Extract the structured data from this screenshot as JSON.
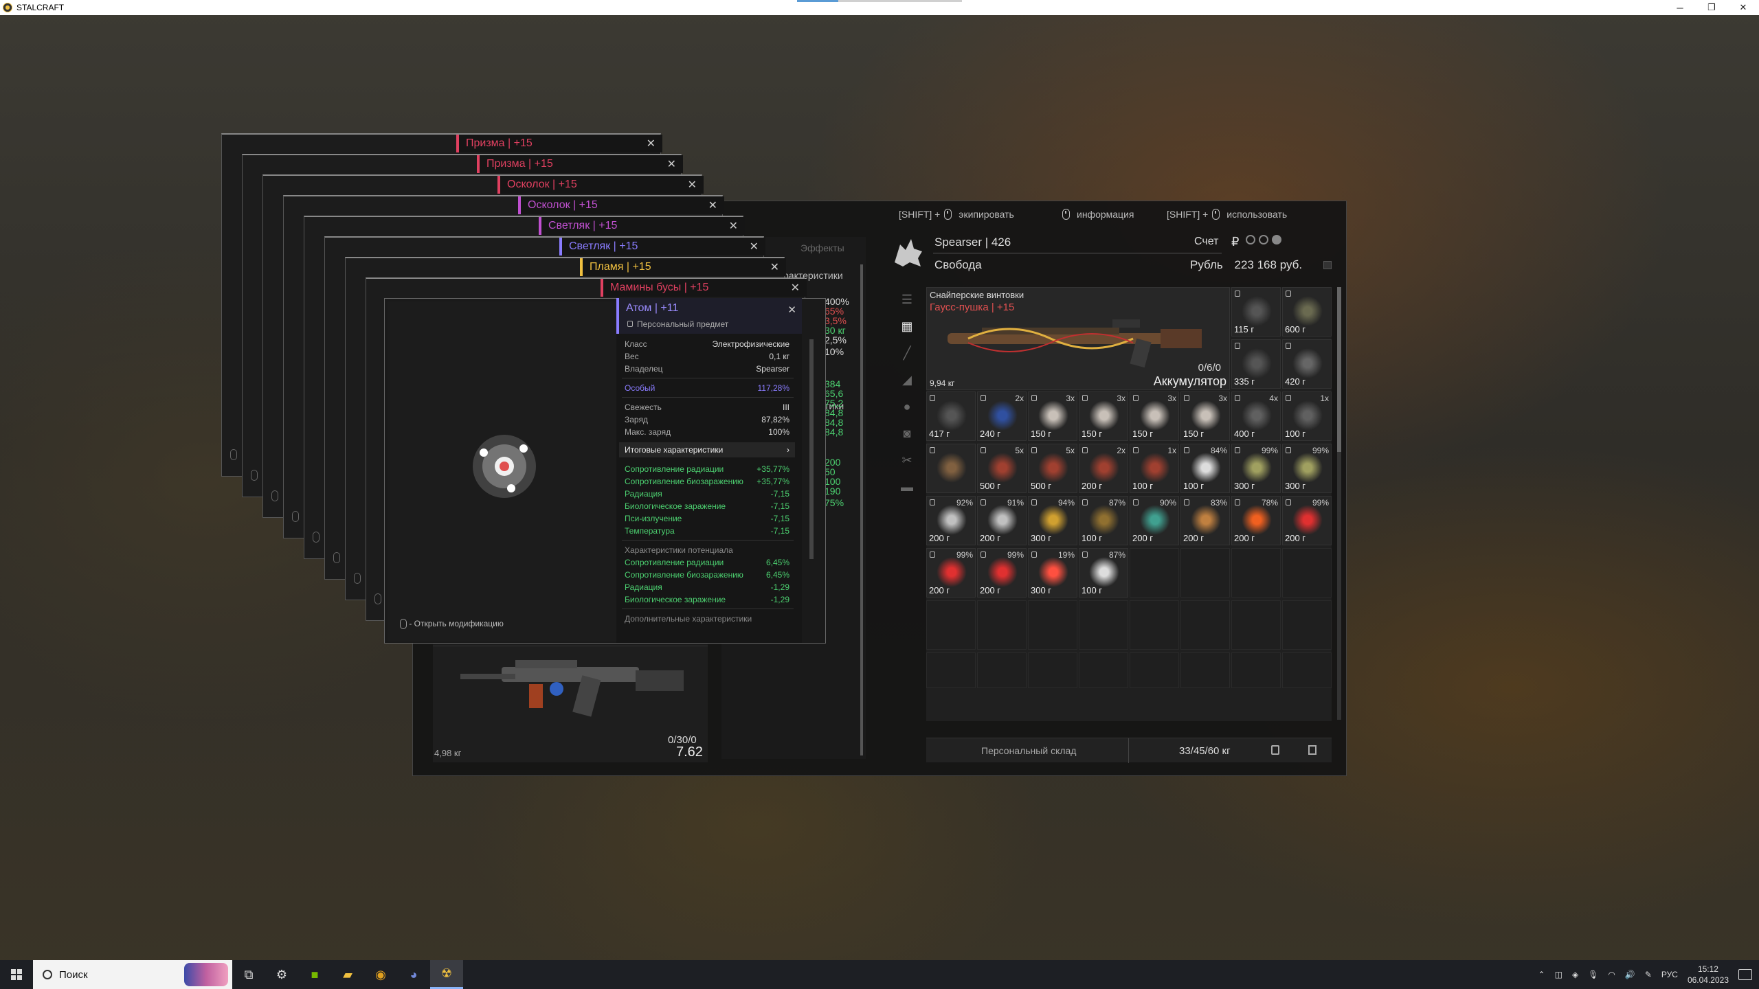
{
  "window": {
    "title": "STALCRAFT",
    "progress": 0.25,
    "buttons": [
      "─",
      "❐",
      "✕"
    ]
  },
  "hints": {
    "equip_shift": "[SHIFT] +",
    "equip": "экипировать",
    "info": "информация",
    "use_shift": "[SHIFT] +",
    "use": "использовать"
  },
  "profile": {
    "name": "Spearser | 426",
    "faction": "Свобода",
    "account_label": "Счет",
    "currency_label": "Рубль",
    "money": "223 168 руб.",
    "currency_symbol": "₽"
  },
  "mid_panel": {
    "tab_effects": "Эффекты",
    "tab_char": "рактеристики",
    "tab_char2": "тики",
    "values": [
      {
        "t": "400%",
        "c": "#dddddd"
      },
      {
        "t": "65%",
        "c": "#e05050"
      },
      {
        "t": "3,5%",
        "c": "#e05050"
      },
      {
        "t": "30 кг",
        "c": "#4cd070"
      },
      {
        "t": "2,5%",
        "c": "#dddddd"
      },
      {
        "t": "10%",
        "c": "#dddddd"
      },
      {
        "t": "384",
        "c": "#4cd070"
      },
      {
        "t": "65,6",
        "c": "#4cd070"
      },
      {
        "t": "75,2",
        "c": "#4cd070"
      },
      {
        "t": "84,8",
        "c": "#4cd070"
      },
      {
        "t": "84,8",
        "c": "#4cd070"
      },
      {
        "t": "84,8",
        "c": "#4cd070"
      },
      {
        "t": "200",
        "c": "#4cd070"
      },
      {
        "t": "50",
        "c": "#4cd070"
      },
      {
        "t": "100",
        "c": "#4cd070"
      },
      {
        "t": "190",
        "c": "#4cd070"
      },
      {
        "t": "75%",
        "c": "#4cd070"
      }
    ]
  },
  "left_weapon": {
    "weight": "4,98 кг",
    "ammo": "0/30/0",
    "caliber": "7.62"
  },
  "inventory": {
    "category": "Снайперские винтовки",
    "weapon_name": "Гаусс-пушка | +15",
    "weapon_ammo": "0/6/0",
    "weapon_accessory": "Аккумулятор",
    "weapon_weight": "9,94 кг",
    "storage_label": "Персональный склад",
    "storage_weight": "33/45/60 кг",
    "items": [
      {
        "w": "115 г",
        "q": "",
        "c": "#555"
      },
      {
        "w": "600 г",
        "q": "",
        "c": "#6a6a50"
      },
      {
        "w": "335 г",
        "q": "",
        "c": "#555"
      },
      {
        "w": "420 г",
        "q": "",
        "c": "#666"
      },
      {
        "w": "417 г",
        "q": "",
        "c": "#555"
      },
      {
        "w": "240 г",
        "q": "2x",
        "c": "#3050a0"
      },
      {
        "w": "150 г",
        "q": "3x",
        "c": "#c8c0b8"
      },
      {
        "w": "150 г",
        "q": "3x",
        "c": "#c8c0b8"
      },
      {
        "w": "150 г",
        "q": "3x",
        "c": "#c8c0b8"
      },
      {
        "w": "150 г",
        "q": "3x",
        "c": "#c8c0b8"
      },
      {
        "w": "400 г",
        "q": "4x",
        "c": "#606060"
      },
      {
        "w": "100 г",
        "q": "1x",
        "c": "#606060"
      },
      {
        "w": "",
        "q": "",
        "c": "#806040"
      },
      {
        "w": "500 г",
        "q": "5x",
        "c": "#a04030"
      },
      {
        "w": "500 г",
        "q": "5x",
        "c": "#a04030"
      },
      {
        "w": "200 г",
        "q": "2x",
        "c": "#a04030"
      },
      {
        "w": "100 г",
        "q": "1x",
        "c": "#a04030"
      },
      {
        "w": "100 г",
        "q": "84%",
        "c": "#dddddd"
      },
      {
        "w": "300 г",
        "q": "99%",
        "c": "#a0a060"
      },
      {
        "w": "300 г",
        "q": "99%",
        "c": "#a0a060"
      },
      {
        "w": "200 г",
        "q": "92%",
        "c": "#c0c0c0"
      },
      {
        "w": "200 г",
        "q": "91%",
        "c": "#c0c0c0"
      },
      {
        "w": "300 г",
        "q": "94%",
        "c": "#d0a030"
      },
      {
        "w": "100 г",
        "q": "87%",
        "c": "#907030"
      },
      {
        "w": "200 г",
        "q": "90%",
        "c": "#40a090"
      },
      {
        "w": "200 г",
        "q": "83%",
        "c": "#c08040"
      },
      {
        "w": "200 г",
        "q": "78%",
        "c": "#f06020"
      },
      {
        "w": "200 г",
        "q": "99%",
        "c": "#e03030"
      },
      {
        "w": "200 г",
        "q": "99%",
        "c": "#e03030"
      },
      {
        "w": "200 г",
        "q": "99%",
        "c": "#e03030"
      },
      {
        "w": "300 г",
        "q": "19%",
        "c": "#ff5040"
      },
      {
        "w": "100 г",
        "q": "87%",
        "c": "#dddddd"
      }
    ]
  },
  "popups": [
    {
      "label": "Призма | +15",
      "color": "#e04060"
    },
    {
      "label": "Призма | +15",
      "color": "#e04060"
    },
    {
      "label": "Осколок | +15",
      "color": "#e04060"
    },
    {
      "label": "Осколок | +15",
      "color": "#c050d0"
    },
    {
      "label": "Светляк | +15",
      "color": "#c050d0"
    },
    {
      "label": "Светляк | +15",
      "color": "#8a7cff"
    },
    {
      "label": "Пламя | +15",
      "color": "#f0c040"
    },
    {
      "label": "Мамины бусы | +15",
      "color": "#e04060"
    }
  ],
  "detail": {
    "name": "Атом | +11",
    "personal": "Персональный предмет",
    "mod_hint": "- Открыть модификацию",
    "rows1": [
      {
        "l": "Класс",
        "v": "Электрофизические"
      },
      {
        "l": "Вес",
        "v": "0,1 кг"
      },
      {
        "l": "Владелец",
        "v": "Spearser"
      }
    ],
    "rarity": {
      "l": "Особый",
      "v": "117,28%"
    },
    "rows2": [
      {
        "l": "Свежесть",
        "v": "III"
      },
      {
        "l": "Заряд",
        "v": "87,82%"
      },
      {
        "l": "Макс. заряд",
        "v": "100%"
      }
    ],
    "final_title": "Итоговые характеристики",
    "final": [
      {
        "l": "Сопротивление радиации",
        "v": "+35,77%"
      },
      {
        "l": "Сопротивление биозаражению",
        "v": "+35,77%"
      },
      {
        "l": "Радиация",
        "v": "-7,15"
      },
      {
        "l": "Биологическое заражение",
        "v": "-7,15"
      },
      {
        "l": "Пси-излучение",
        "v": "-7,15"
      },
      {
        "l": "Температура",
        "v": "-7,15"
      }
    ],
    "pot_title": "Характеристики потенциала",
    "potential": [
      {
        "l": "Сопротивление радиации",
        "v": "6,45%"
      },
      {
        "l": "Сопротивление биозаражению",
        "v": "6,45%"
      },
      {
        "l": "Радиация",
        "v": "-1,29"
      },
      {
        "l": "Биологическое заражение",
        "v": "-1,29"
      }
    ],
    "extra_title": "Дополнительные характеристики"
  },
  "taskbar": {
    "search_placeholder": "Поиск",
    "lang": "РУС",
    "time": "15:12",
    "date": "06.04.2023"
  }
}
